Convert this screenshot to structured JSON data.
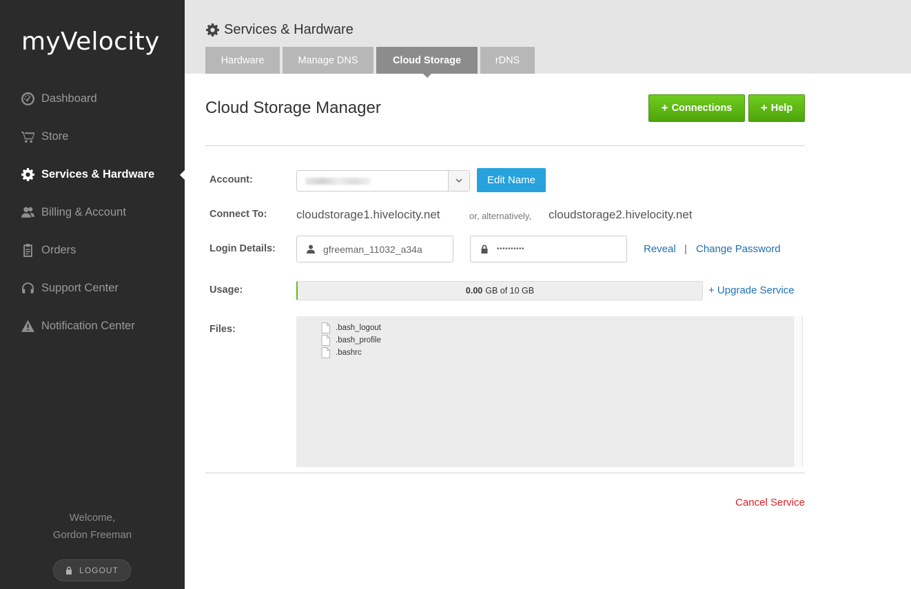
{
  "app": {
    "brand": "myVelocity"
  },
  "sidebar": {
    "items": [
      {
        "label": "Dashboard",
        "icon": "dashboard-icon"
      },
      {
        "label": "Store",
        "icon": "cart-icon"
      },
      {
        "label": "Services & Hardware",
        "icon": "gear-icon",
        "active": true
      },
      {
        "label": "Billing & Account",
        "icon": "users-icon"
      },
      {
        "label": "Orders",
        "icon": "clipboard-icon"
      },
      {
        "label": "Support Center",
        "icon": "headset-icon"
      },
      {
        "label": "Notification Center",
        "icon": "warning-icon"
      }
    ],
    "welcome_line1": "Welcome,",
    "welcome_line2": "Gordon Freeman",
    "logout_label": "LOGOUT"
  },
  "header": {
    "title": "Services & Hardware",
    "tabs": [
      {
        "label": "Hardware"
      },
      {
        "label": "Manage DNS"
      },
      {
        "label": "Cloud Storage",
        "active": true
      },
      {
        "label": "rDNS"
      }
    ]
  },
  "main": {
    "title": "Cloud Storage Manager",
    "connections_label": "Connections",
    "help_label": "Help",
    "account_label": "Account:",
    "edit_name_label": "Edit Name",
    "connect_label": "Connect To:",
    "host1": "cloudstorage1.hivelocity.net",
    "alt_text": "or, alternatively,",
    "host2": "cloudstorage2.hivelocity.net",
    "login_label": "Login Details:",
    "username": "gfreeman_11032_a34a",
    "password_mask": "••••••••••",
    "reveal_label": "Reveal",
    "separator": "|",
    "change_password_label": "Change Password",
    "usage_label": "Usage:",
    "usage_used": "0.00",
    "usage_rest": "GB of 10 GB",
    "usage_fraction": 0,
    "upgrade_label": "+ Upgrade Service",
    "files_label": "Files:",
    "files": [
      ".bash_logout",
      ".bash_profile",
      ".bashrc"
    ],
    "cancel_label": "Cancel Service"
  },
  "colors": {
    "sidebar_bg": "#2b2b2b",
    "accent_green": "#5cb315",
    "accent_blue": "#27a2dd",
    "link_blue": "#1f6fb2",
    "danger_red": "#e02020"
  }
}
